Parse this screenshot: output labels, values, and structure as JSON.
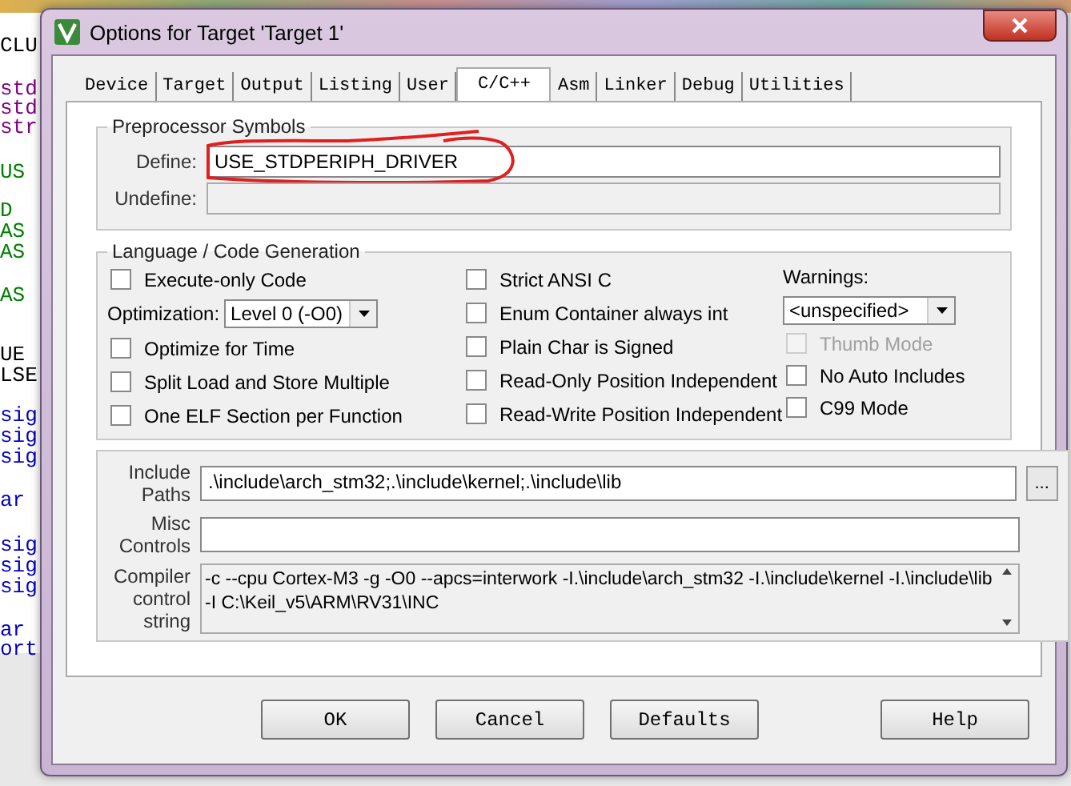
{
  "background_editor": {
    "lines": [
      {
        "text": "CLU",
        "color": "#000000"
      },
      {
        "text": "std",
        "color": "#800080"
      },
      {
        "text": "std",
        "color": "#800080"
      },
      {
        "text": "str",
        "color": "#800080"
      },
      {
        "text": "US",
        "color": "#008000"
      },
      {
        "text": "D",
        "color": "#008000"
      },
      {
        "text": "AS",
        "color": "#008000"
      },
      {
        "text": "AS",
        "color": "#008000"
      },
      {
        "text": "AS",
        "color": "#008000"
      },
      {
        "text": "UE",
        "color": "#000000"
      },
      {
        "text": "LSE",
        "color": "#000000"
      },
      {
        "text": "sig",
        "color": "#0000c0"
      },
      {
        "text": "sig",
        "color": "#0000c0"
      },
      {
        "text": "sig",
        "color": "#0000c0"
      },
      {
        "text": "ar",
        "color": "#0000c0"
      },
      {
        "text": "sig",
        "color": "#0000c0"
      },
      {
        "text": "sig",
        "color": "#0000c0"
      },
      {
        "text": "sig",
        "color": "#0000c0"
      },
      {
        "text": "ar",
        "color": "#0000c0"
      },
      {
        "text": "ort",
        "color": "#0000c0"
      }
    ]
  },
  "window": {
    "title": "Options for Target 'Target 1'"
  },
  "tabs": [
    {
      "label": "Device",
      "selected": false
    },
    {
      "label": "Target",
      "selected": false
    },
    {
      "label": "Output",
      "selected": false
    },
    {
      "label": "Listing",
      "selected": false
    },
    {
      "label": "User",
      "selected": false
    },
    {
      "label": "C/C++",
      "selected": true
    },
    {
      "label": "Asm",
      "selected": false
    },
    {
      "label": "Linker",
      "selected": false
    },
    {
      "label": "Debug",
      "selected": false
    },
    {
      "label": "Utilities",
      "selected": false
    }
  ],
  "preprocessor_symbols": {
    "title": "Preprocessor Symbols",
    "define": {
      "label": "Define:",
      "value": "USE_STDPERIPH_DRIVER",
      "disabled": false
    },
    "undefine": {
      "label": "Undefine:",
      "disabled": true
    }
  },
  "language_code_generation": {
    "title": "Language / Code Generation",
    "column_1": [
      {
        "kind": "checkbox",
        "label": "Execute-only Code",
        "checked": false,
        "disabled": false
      },
      {
        "kind": "dropdown",
        "label": "Optimization:",
        "value": "Level 0 (-O0)"
      },
      {
        "kind": "checkbox",
        "label": "Optimize for Time",
        "checked": false,
        "disabled": false
      },
      {
        "kind": "checkbox",
        "label": "Split Load and Store Multiple",
        "checked": false,
        "disabled": false
      },
      {
        "kind": "checkbox",
        "label": "One ELF Section per Function",
        "checked": false,
        "disabled": false
      }
    ],
    "column_2": [
      {
        "kind": "checkbox",
        "label": "Strict ANSI C",
        "checked": false,
        "disabled": false
      },
      {
        "kind": "checkbox",
        "label": "Enum Container always int",
        "checked": false,
        "disabled": false
      },
      {
        "kind": "checkbox",
        "label": "Plain Char is Signed",
        "checked": false,
        "disabled": false
      },
      {
        "kind": "checkbox",
        "label": "Read-Only Position Independent",
        "checked": false,
        "disabled": false
      },
      {
        "kind": "checkbox",
        "label": "Read-Write Position Independent",
        "checked": false,
        "disabled": false
      }
    ],
    "column_3": [
      {
        "kind": "label",
        "label": "Warnings:"
      },
      {
        "kind": "dropdown",
        "value": "<unspecified>"
      },
      {
        "kind": "checkbox",
        "label": "Thumb Mode",
        "checked": false,
        "disabled": true
      },
      {
        "kind": "checkbox",
        "label": "No Auto Includes",
        "checked": false,
        "disabled": false
      },
      {
        "kind": "checkbox",
        "label": "C99 Mode",
        "checked": false,
        "disabled": false
      }
    ]
  },
  "include_paths": {
    "label": "Include Paths",
    "value": ".\\include\\arch_stm32;.\\include\\kernel;.\\include\\lib",
    "browse": "..."
  },
  "misc_controls": {
    "label": "Misc Controls"
  },
  "compiler_control_string": {
    "label": "Compiler control string",
    "value": "-c --cpu Cortex-M3 -g -O0 --apcs=interwork -I.\\include\\arch_stm32 -I.\\include\\kernel -I.\\include\\lib\n-I C:\\Keil_v5\\ARM\\RV31\\INC"
  },
  "buttons": [
    "OK",
    "Cancel",
    "Defaults",
    "Help"
  ]
}
